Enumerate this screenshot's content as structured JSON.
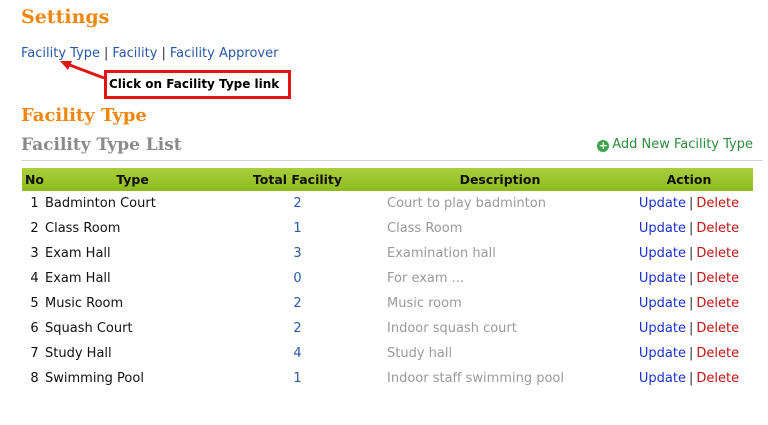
{
  "header": {
    "title": "Settings"
  },
  "nav": {
    "links": [
      "Facility Type",
      "Facility",
      "Facility Approver"
    ],
    "separator": "|"
  },
  "callout": {
    "text": "Click on Facility Type link",
    "color": "#e01616"
  },
  "section": {
    "title": "Facility Type",
    "list_title": "Facility Type List"
  },
  "add_button": {
    "label": "Add New Facility Type",
    "icon": "plus-circle-icon"
  },
  "table": {
    "headers": [
      "No",
      "Type",
      "Total Facility",
      "Description",
      "Action"
    ],
    "rows": [
      {
        "no": "1",
        "type": "Badminton Court",
        "total": "2",
        "desc": "Court to play badminton"
      },
      {
        "no": "2",
        "type": "Class Room",
        "total": "1",
        "desc": "Class Room"
      },
      {
        "no": "3",
        "type": "Exam Hall",
        "total": "3",
        "desc": "Examination hall"
      },
      {
        "no": "4",
        "type": "Exam Hall",
        "total": "0",
        "desc": "For exam ..."
      },
      {
        "no": "5",
        "type": "Music Room",
        "total": "2",
        "desc": "Music room"
      },
      {
        "no": "6",
        "type": "Squash Court",
        "total": "2",
        "desc": "Indoor squash court"
      },
      {
        "no": "7",
        "type": "Study Hall",
        "total": "4",
        "desc": "Study hall"
      },
      {
        "no": "8",
        "type": "Swimming Pool",
        "total": "1",
        "desc": "Indoor staff swimming pool"
      }
    ],
    "action_update": "Update",
    "action_delete": "Delete",
    "action_sep": "|"
  },
  "colors": {
    "heading": "#f0860e",
    "header_bar": "#9cc42c",
    "link": "#2a57a6",
    "delete": "#c11414"
  }
}
